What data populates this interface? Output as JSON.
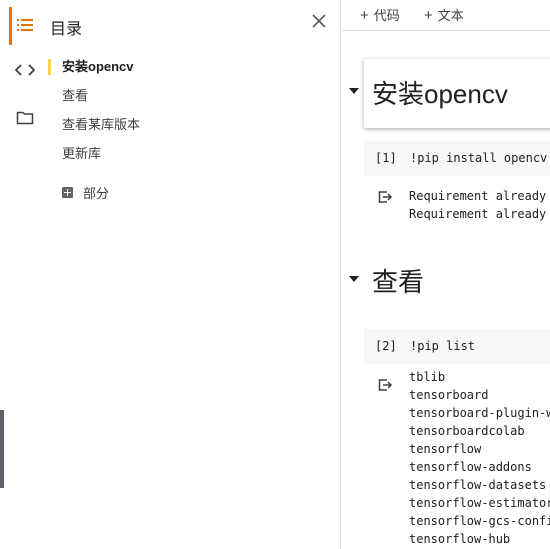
{
  "rail": {
    "items": [
      {
        "icon": "toc-icon",
        "active": true
      },
      {
        "icon": "code-icon",
        "active": false
      },
      {
        "icon": "folder-icon",
        "active": false
      }
    ]
  },
  "toc": {
    "title": "目录",
    "items": [
      {
        "label": "安装opencv",
        "active": true
      },
      {
        "label": "查看",
        "active": false
      },
      {
        "label": "查看某库版本",
        "active": false
      },
      {
        "label": "更新库",
        "active": false
      }
    ],
    "add_section_label": "部分"
  },
  "toolbar": {
    "add_code_label": "代码",
    "add_text_label": "文本",
    "plus_glyph": "+"
  },
  "notebook": {
    "sections": [
      {
        "heading": "安装opencv"
      },
      {
        "heading": "查看"
      }
    ],
    "cells": [
      {
        "exec": "[1]",
        "source": "!pip  install  opencv",
        "output": "Requirement already\nRequirement already"
      },
      {
        "exec": "[2]",
        "source": "!pip  list",
        "output": "tblib\ntensorboard\ntensorboard-plugin-wit\ntensorboardcolab\ntensorflow\ntensorflow-addons\ntensorflow-datasets\ntensorflow-estimator\ntensorflow-gcs-config\ntensorflow-hub"
      }
    ]
  },
  "colors": {
    "accent": "#e8710a",
    "toc_active_marker": "#fbd44b",
    "code_bg": "#f7f7f7"
  }
}
